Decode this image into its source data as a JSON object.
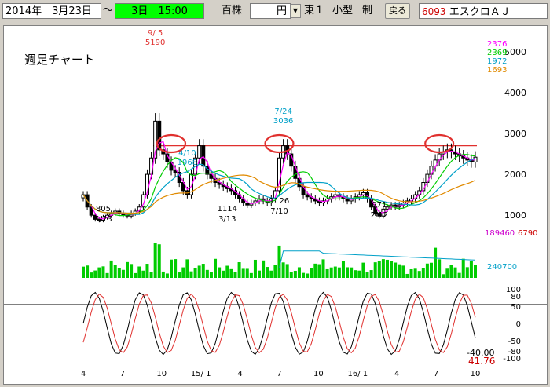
{
  "toolbar": {
    "start_date": "2014年　3月23日",
    "range_sep": "～",
    "period": "3日　15:00",
    "unit_label": "百株",
    "currency": "円",
    "market": "東１",
    "size_class": "小型",
    "margin": "制",
    "back_button": "戻る",
    "code": "6093",
    "name": "エスクロＡＪ"
  },
  "colors": {
    "period_bg": "#00ff00",
    "code_text": "#cc0000",
    "ma1": "#ff00ff",
    "ma2": "#00cc00",
    "ma3": "#00a0c8",
    "ma4": "#e08a00",
    "annotation": "#e0302e"
  },
  "chart_data": [
    {
      "type": "candlestick",
      "title": "週足チャート",
      "ylim": [
        600,
        5400
      ],
      "y_ticks": [
        "5000",
        "4000",
        "3000",
        "2000",
        "1000"
      ],
      "x_ticks": [
        "4",
        "7",
        "10",
        "15/ 1",
        "4",
        "7",
        "10",
        "16/ 1",
        "4",
        "7",
        "10"
      ],
      "moving_average_values": [
        2376,
        2369,
        1972,
        1693
      ],
      "annotations": [
        {
          "date": "9/ 5",
          "value": "5190",
          "kind": "high"
        },
        {
          "date": "7/24",
          "value": "3036",
          "kind": "high"
        },
        {
          "date": "4/10",
          "value": "1968",
          "kind": "high"
        },
        {
          "value": "805",
          "date": "5/23",
          "kind": "low"
        },
        {
          "value": "1114",
          "date": "3/13",
          "kind": "low"
        },
        {
          "value": "1126",
          "date": "7/10",
          "kind": "low"
        },
        {
          "value": "971",
          "date": "2/12",
          "kind": "low"
        }
      ],
      "resistance_line": 2700,
      "closes": [
        1500,
        1200,
        1000,
        900,
        880,
        950,
        1000,
        1050,
        1100,
        1050,
        1000,
        980,
        1050,
        1100,
        1200,
        1500,
        2000,
        2400,
        3300,
        2600,
        2500,
        2300,
        2100,
        2050,
        1800,
        1600,
        1500,
        2000,
        2400,
        2700,
        2200,
        2000,
        1900,
        1800,
        1750,
        1700,
        1650,
        1600,
        1500,
        1400,
        1300,
        1250,
        1300,
        1350,
        1400,
        1350,
        1300,
        1400,
        1600,
        2400,
        2700,
        2500,
        2200,
        1900,
        1700,
        1500,
        1450,
        1400,
        1350,
        1300,
        1350,
        1400,
        1450,
        1500,
        1450,
        1400,
        1350,
        1400,
        1450,
        1500,
        1550,
        1400,
        1200,
        1050,
        980,
        1150,
        1200,
        1250,
        1200,
        1250,
        1300,
        1350,
        1400,
        1500,
        1600,
        1800,
        2000,
        2200,
        2350,
        2500,
        2550,
        2600,
        2550,
        2500,
        2450,
        2400,
        2350,
        2300,
        2420
      ]
    },
    {
      "type": "bar",
      "title": "volume",
      "max_label": "189460",
      "right_label": "6790",
      "ma_label": "240700"
    },
    {
      "type": "line",
      "title": "stochastics",
      "ylim": [
        -100,
        100
      ],
      "y_ticks": [
        "100",
        "80",
        "50",
        "0",
        "-50",
        "-80",
        "-100"
      ],
      "labels": [
        "-40.00",
        "41.76"
      ]
    }
  ]
}
